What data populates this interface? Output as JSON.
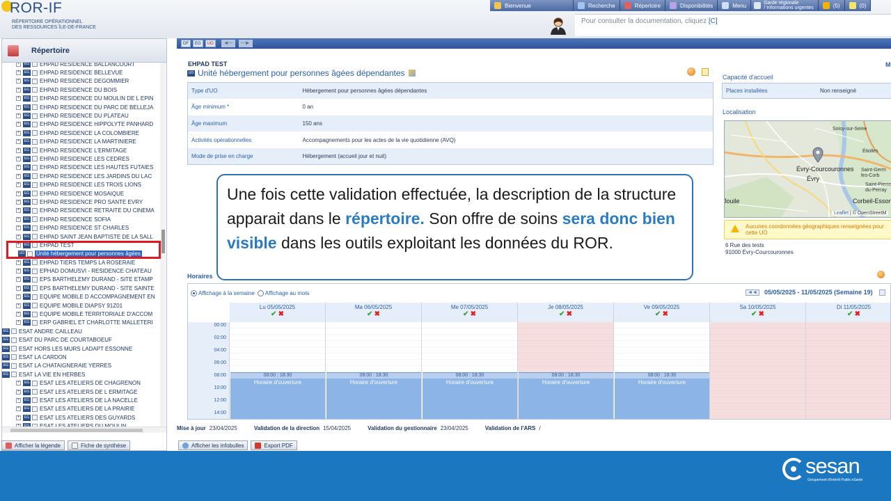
{
  "header": {
    "logo_name": "ROR-IF",
    "logo_sub1": "RÉPERTOIRE OPÉRATIONNEL",
    "logo_sub2": "DES RESSOURCES ÎLE-DE-FRANCE",
    "nav": [
      {
        "label": "Bienvenue",
        "icon": "user-icon",
        "color": "#f2c44f"
      },
      {
        "label": "Recherche",
        "icon": "search-icon",
        "color": "#9ec6f0"
      },
      {
        "label": "Répertoire",
        "icon": "book-icon",
        "color": "#e06060"
      },
      {
        "label": "Disponibilités",
        "icon": "availability-icon",
        "color": "#b8a4e0"
      },
      {
        "label": "Menu",
        "icon": "menu-icon",
        "color": "#cfe0f5"
      }
    ],
    "garde_line1": "Garde régionale",
    "garde_line2": "/ Informations urgentes",
    "alerts": "(5)",
    "messages": "(0)",
    "doc_hint_text": "Pour consulter la documentation, cliquez ",
    "doc_hint_link": "[C]"
  },
  "sidebar": {
    "title": "Répertoire",
    "items": [
      "EHPAD RESIDENCE BALLANCOURT",
      "EHPAD RESIDENCE BELLEVUE",
      "EHPAD RESIDENCE DEGOMMIER",
      "EHPAD RESIDENCE DU BOIS",
      "EHPAD RESIDENCE DU MOULIN DE L EPIN",
      "EHPAD RESIDENCE DU PARC DE BELLEJA",
      "EHPAD RESIDENCE DU PLATEAU",
      "EHPAD RESIDENCE HIPPOLYTE PANHARD",
      "EHPAD RESIDENCE LA COLOMBIERE",
      "EHPAD RESIDENCE LA MARTINIERE",
      "EHPAD RESIDENCE L'ERMITAGE",
      "EHPAD RESIDENCE LES CEDRES",
      "EHPAD RESIDENCE LES HAUTES FUTAIES",
      "EHPAD RESIDENCE LES JARDINS DU LAC",
      "EHPAD RESIDENCE LES TROIS LIONS",
      "EHPAD RESIDENCE MOSAIQUE",
      "EHPAD RESIDENCE PRO SANTE EVRY",
      "EHPAD RESIDENCE RETRAITE DU CINEMA",
      "EHPAD RESIDENCE SOFIA",
      "EHPAD RESIDENCE ST CHARLES",
      "EHPAD SAINT JEAN BAPTISTE DE LA SALL",
      "EHPAD TEST"
    ],
    "selected_uo": "Unité hébergement pour personnes âgées",
    "items_after": [
      "EHPAD TIERS TEMPS LA ROSERAIE",
      "EPHAD DOMUSVI - RESIDENCE CHATEAU",
      "EPS BARTHELEMY DURAND - SITE ETAMP",
      "EPS BARTHELEMY DURAND - SITE SAINTE",
      "EQUIPE MOBILE D ACCOMPAGNEMENT EN",
      "EQUIPE MOBILE DIAPSY 91Z01",
      "EQUIPE MOBILE TERRITORIALE D'ACCOM",
      "ERP GABRIEL ET CHARLOTTE MALLETERI",
      "ESAT ANDRE CAILLEAU",
      "ESAT DU PARC DE COURTABOEUF",
      "ESAT HORS LES MURS LADAPT ESSONNE",
      "ESAT LA CARDON",
      "ESAT LA CHATAIGNERAIE YERRES",
      "ESAT LA VIE EN HERBES",
      "ESAT LES ATELIERS DE CHAGRENON",
      "ESAT LES ATELIERS DE L ERMITAGE",
      "ESAT LES ATELIERS DE LA NACELLE",
      "ESAT LES ATELIERS DE LA PRAIRIE",
      "ESAT LES ATELIERS DES GUYARDS",
      "ESAT LES ATELIERS DU MOULIN"
    ],
    "badge_eg": "EG",
    "badge_uo": "UO",
    "footer_legend": "Afficher la légende",
    "footer_synth": "Fiche de synthèse"
  },
  "main": {
    "toolbar": [
      "DF",
      "EG",
      "UO"
    ],
    "toolbar_prev": "◄─",
    "toolbar_next": "─►",
    "structure_name": "EHPAD TEST",
    "uo_badge": "UO",
    "uo_title": "Unité hébergement pour personnes âgées dépendantes",
    "info": [
      {
        "k": "Type d'UO",
        "v": "Hébergement pour personnes âgées dépendantes"
      },
      {
        "k": "Âge minimum *",
        "v": "0 an"
      },
      {
        "k": "Âge maximum",
        "v": "150 ans"
      },
      {
        "k": "Activités opérationnelles",
        "v": "Accompagnements pour les actes de la vie quotidienne (AVQ)"
      },
      {
        "k": "Mode de prise en charge",
        "v": "Hébergement (accueil jour et nuit)"
      }
    ],
    "right_m": "M",
    "capacity_title": "Capacité d'accueil",
    "capacity_key": "Places installées",
    "capacity_value": "Non renseigné",
    "location_title": "Localisation",
    "map_labels": {
      "soisy": "Soisy-sur-Seine",
      "etiolles": "Étiolles",
      "evry_c": "Évry-Courcouronnes",
      "evry": "Évry",
      "saint_germain": "Saint-Germ les-Corb",
      "saint_pierre": "Saint-Pierre du-Perray",
      "corbeil": "Corbeil-Essonn",
      "fouille": "Jouile"
    },
    "map_attr_link": "Leaflet",
    "map_attr_text": " | © OpenStreetM",
    "geo_warning": "Aucunes coordonnées géographiques renseignées pour cette UO",
    "address_line1": "6 Rue des tests",
    "address_line2": "91000 Évry-Courcouronnes",
    "horaires_title": "Horaires",
    "view_week": "Affichage à la semaine",
    "view_month": "Affichage au mois",
    "week_prev": "◄◄",
    "week_label": "05/05/2025 - 11/05/2025 (Semaine 19)",
    "days": [
      {
        "name": "Lu 05/05/2025",
        "closed": false
      },
      {
        "name": "Ma 06/05/2025",
        "closed": false
      },
      {
        "name": "Me 07/05/2025",
        "closed": false
      },
      {
        "name": "Je 08/05/2025",
        "closed": true
      },
      {
        "name": "Ve 09/05/2025",
        "closed": false
      },
      {
        "name": "Sa 10/05/2025",
        "closed": true
      },
      {
        "name": "Di 11/05/2025",
        "closed": true
      }
    ],
    "check_mark": "✔",
    "cross_mark": "✖",
    "times": [
      "00:00",
      "02:00",
      "04:00",
      "06:00",
      "08:00",
      "10:00",
      "12:00",
      "14:00"
    ],
    "slot_time": "08:00 : 18:30",
    "slot_label": "Horaire d'ouverture",
    "status": {
      "maj_label": "Mise à jour",
      "maj_value": "23/04/2025",
      "direction_label": "Validation de la direction",
      "direction_value": "15/04/2025",
      "gest_label": "Validation du gestionnaire",
      "gest_value": "23/04/2025",
      "ars_label": "Validation de l'ARS",
      "ars_value": "/"
    },
    "footer_infobulles": "Afficher les infobulles",
    "footer_pdf": "Export PDF"
  },
  "callout": {
    "t1": "Une fois cette validation effectuée, la description de la structure apparait dans le ",
    "h1": "répertoire.",
    "t2": " Son offre de soins ",
    "h2": "sera donc bien visible",
    "t3": " dans les outils exploitant les données du ROR."
  },
  "footer": {
    "brand": "sesan",
    "tagline": "Groupement d'Intérêt Public eSanté"
  },
  "colors": {
    "nav_blue": "#4c6aa3",
    "link_blue": "#2a5fa8",
    "highlight_red": "#e01820",
    "footer_blue": "#1b77bf",
    "slot_blue": "#8cb4e6",
    "closed_pink": "#f6dede"
  }
}
